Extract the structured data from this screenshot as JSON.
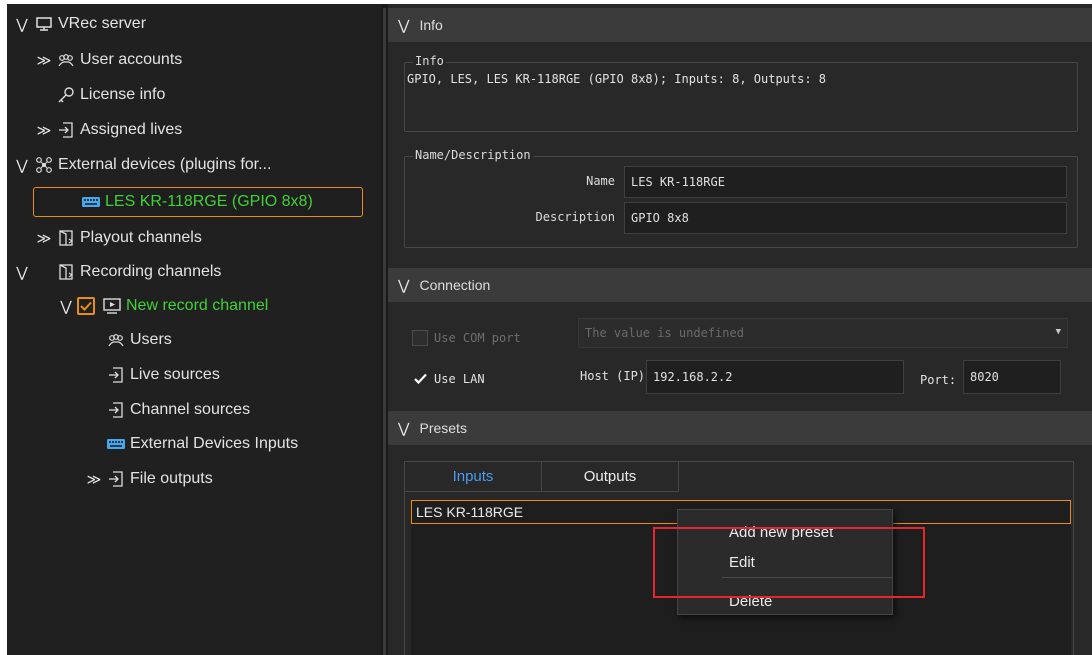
{
  "tree": {
    "items": [
      {
        "label": "VRec server"
      },
      {
        "label": "User accounts"
      },
      {
        "label": "License info"
      },
      {
        "label": "Assigned lives"
      },
      {
        "label": "External devices (plugins for..."
      },
      {
        "label": "LES KR-118RGE (GPIO 8x8)"
      },
      {
        "label": "Playout channels"
      },
      {
        "label": "Recording channels"
      },
      {
        "label": "New record channel"
      },
      {
        "label": "Users"
      },
      {
        "label": "Live sources"
      },
      {
        "label": "Channel sources"
      },
      {
        "label": "External Devices Inputs"
      },
      {
        "label": "File outputs"
      }
    ]
  },
  "info": {
    "header": "Info",
    "group_title": "Info",
    "text": "GPIO, LES, LES KR-118RGE (GPIO 8x8); Inputs: 8, Outputs: 8"
  },
  "name_desc": {
    "group_title": "Name/Description",
    "name_label": "Name",
    "name_value": "LES KR-118RGE",
    "desc_label": "Description",
    "desc_value": "GPIO 8x8"
  },
  "connection": {
    "header": "Connection",
    "use_com_label": "Use COM port",
    "use_com_checked": false,
    "com_value": "The value is undefined",
    "use_lan_label": "Use LAN",
    "use_lan_checked": true,
    "host_label": "Host (IP):",
    "host_value": "192.168.2.2",
    "port_label": "Port:",
    "port_value": "8020"
  },
  "presets": {
    "header": "Presets",
    "tabs": [
      {
        "label": "Inputs"
      },
      {
        "label": "Outputs"
      }
    ],
    "active_tab": "Inputs",
    "rows": [
      {
        "label": "LES KR-118RGE"
      }
    ]
  },
  "context_menu": {
    "items": [
      {
        "label": "Add new preset"
      },
      {
        "label": "Edit"
      },
      {
        "label": "Delete"
      }
    ]
  },
  "colors": {
    "accent_orange": "#e88e15",
    "active_green": "#3fd233",
    "tab_blue": "#4a9cf0",
    "highlight_red": "#e5262c"
  }
}
